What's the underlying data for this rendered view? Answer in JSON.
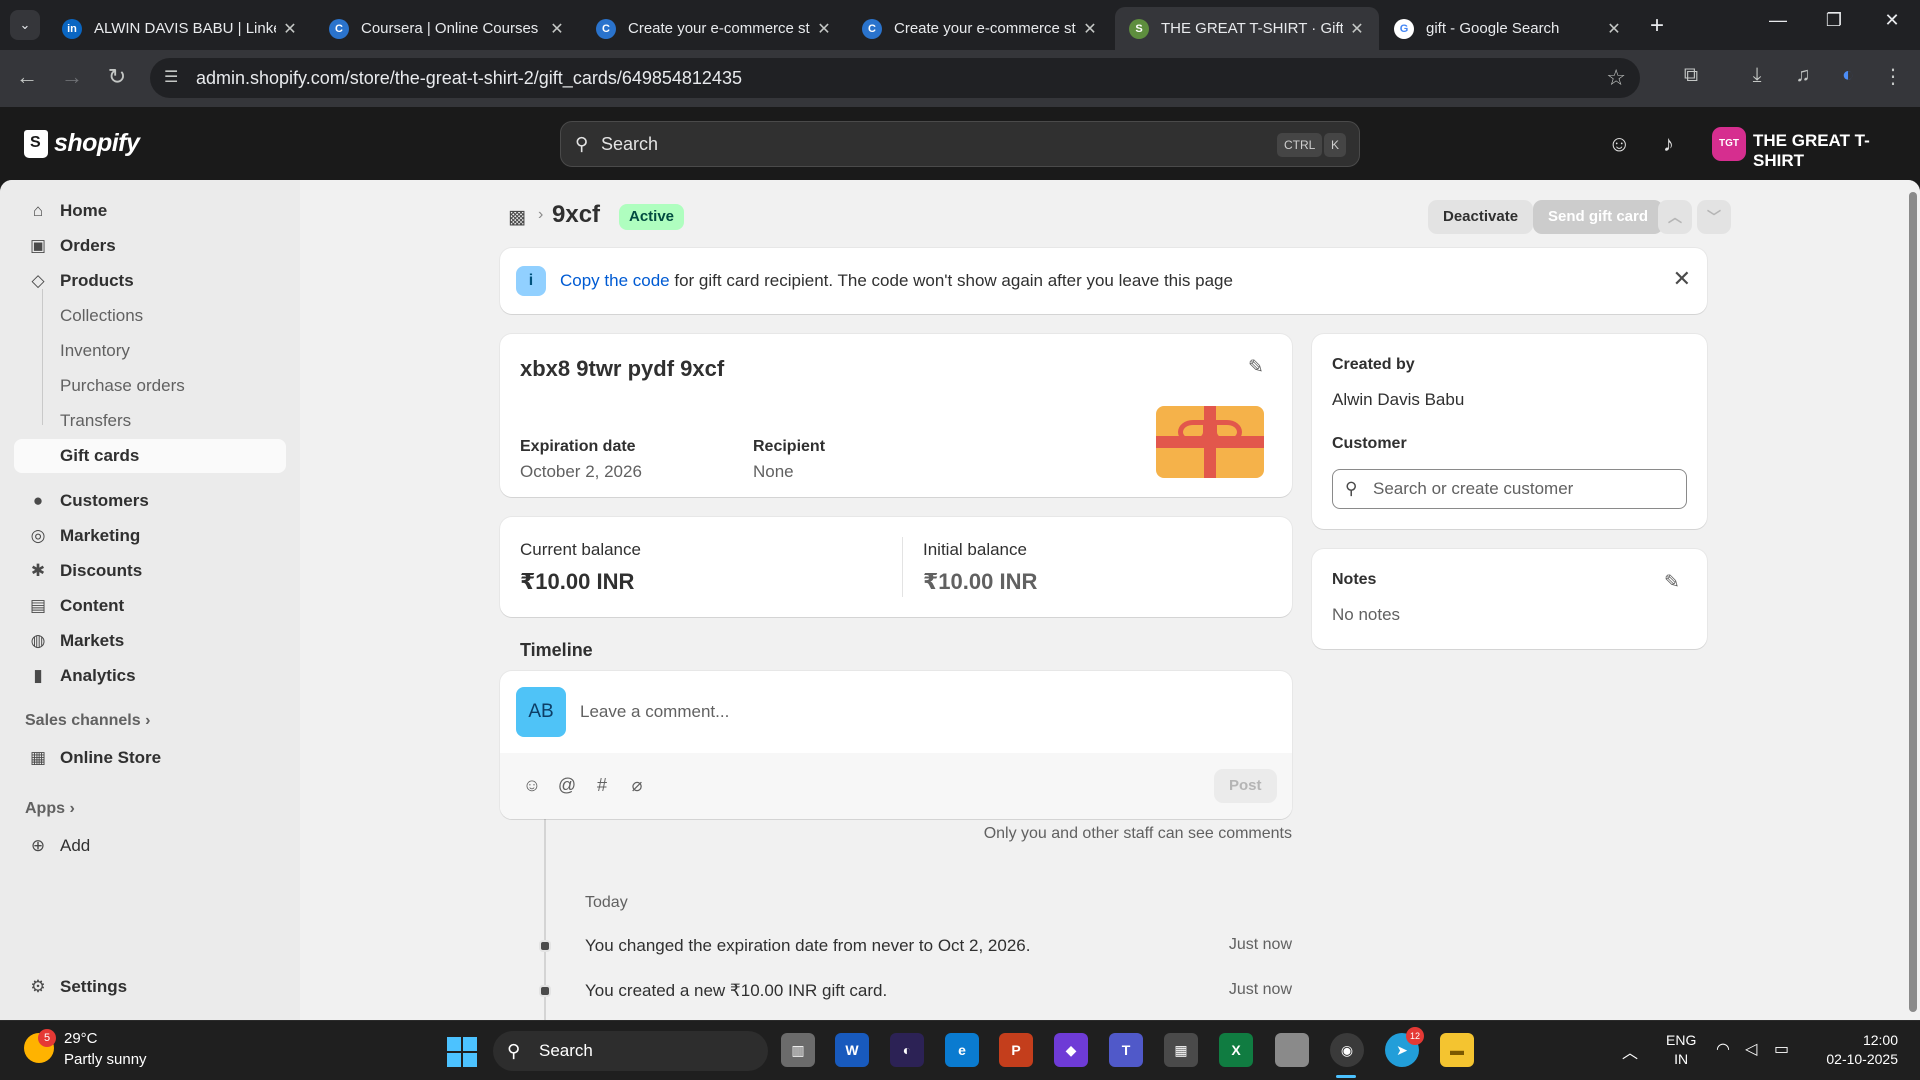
{
  "browser": {
    "tabs": [
      {
        "title": "ALWIN DAVIS BABU | LinkedIn",
        "icon": "linkedin-icon",
        "color": "#0a66c2",
        "glyph": "in",
        "active": false
      },
      {
        "title": "Coursera | Online Courses &",
        "icon": "coursera-icon",
        "color": "#2a73cc",
        "glyph": "C",
        "active": false
      },
      {
        "title": "Create your e-commerce st",
        "icon": "coursera-icon",
        "color": "#2a73cc",
        "glyph": "C",
        "active": false
      },
      {
        "title": "Create your e-commerce st",
        "icon": "coursera-icon",
        "color": "#2a73cc",
        "glyph": "C",
        "active": false
      },
      {
        "title": "THE GREAT T-SHIRT · Gift c",
        "icon": "shopify-icon",
        "color": "#5e8e3e",
        "glyph": "S",
        "active": true
      },
      {
        "title": "gift - Google Search",
        "icon": "google-icon",
        "color": "#ffffff",
        "glyph": "G",
        "active": false
      }
    ],
    "url": "admin.shopify.com/store/the-great-t-shirt-2/gift_cards/649854812435"
  },
  "topbar": {
    "brand": "shopify",
    "search_label": "Search",
    "shortcut": [
      "CTRL",
      "K"
    ],
    "store_initials": "TGT",
    "store_name": "THE GREAT T-SHIRT"
  },
  "sidebar": {
    "items": [
      {
        "label": "Home",
        "icon": "home-icon",
        "glyph": "⌂"
      },
      {
        "label": "Orders",
        "icon": "orders-icon",
        "glyph": "▣"
      },
      {
        "label": "Products",
        "icon": "tag-icon",
        "glyph": "◇"
      }
    ],
    "product_sub": [
      {
        "label": "Collections"
      },
      {
        "label": "Inventory"
      },
      {
        "label": "Purchase orders"
      },
      {
        "label": "Transfers"
      },
      {
        "label": "Gift cards"
      }
    ],
    "items2": [
      {
        "label": "Customers",
        "icon": "person-icon",
        "glyph": "●"
      },
      {
        "label": "Marketing",
        "icon": "target-icon",
        "glyph": "◎"
      },
      {
        "label": "Discounts",
        "icon": "discount-icon",
        "glyph": "✱"
      },
      {
        "label": "Content",
        "icon": "content-icon",
        "glyph": "▤"
      },
      {
        "label": "Markets",
        "icon": "globe-icon",
        "glyph": "◍"
      },
      {
        "label": "Analytics",
        "icon": "analytics-icon",
        "glyph": "▮"
      }
    ],
    "sales_channels_label": "Sales channels",
    "online_store": "Online Store",
    "apps_label": "Apps",
    "add_label": "Add",
    "settings_label": "Settings"
  },
  "page": {
    "title": "9xcf",
    "status": "Active",
    "deactivate_label": "Deactivate",
    "send_label": "Send gift card",
    "banner": {
      "link": "Copy the code",
      "text": " for gift card recipient. The code won't show again after you leave this page"
    },
    "gift_card": {
      "code": "xbx8 9twr pydf 9xcf",
      "expiration_label": "Expiration date",
      "expiration_value": "October 2, 2026",
      "recipient_label": "Recipient",
      "recipient_value": "None"
    },
    "balance": {
      "current_label": "Current balance",
      "current_value": "₹10.00 INR",
      "initial_label": "Initial balance",
      "initial_value": "₹10.00 INR"
    },
    "timeline": {
      "heading": "Timeline",
      "avatar_initials": "AB",
      "comment_placeholder": "Leave a comment...",
      "post_label": "Post",
      "staff_note": "Only you and other staff can see comments",
      "day": "Today",
      "events": [
        {
          "text": "You changed the expiration date from never to Oct 2, 2026.",
          "time": "Just now"
        },
        {
          "text": "You created a new ₹10.00 INR gift card.",
          "time": "Just now"
        }
      ]
    },
    "created_by_label": "Created by",
    "created_by_value": "Alwin Davis Babu",
    "customer_label": "Customer",
    "customer_placeholder": "Search or create customer",
    "notes_label": "Notes",
    "notes_value": "No notes"
  },
  "taskbar": {
    "weather_temp": "29°C",
    "weather_desc": "Partly sunny",
    "weather_badge": "5",
    "search_label": "Search",
    "lang_1": "ENG",
    "lang_2": "IN",
    "time": "12:00",
    "date": "02-10-2025",
    "telegram_badge": "12"
  }
}
